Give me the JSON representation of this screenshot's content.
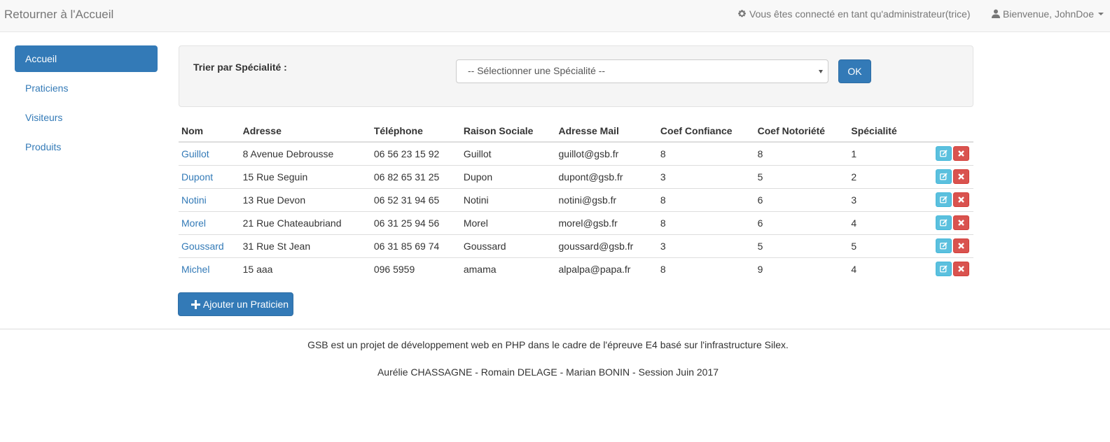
{
  "navbar": {
    "brand": "Retourner à l'Accueil",
    "admin_text": "Vous êtes connecté en tant qu'administrateur(trice)",
    "admin_icon": "gear-icon",
    "user_text": "Bienvenue, JohnDoe",
    "user_icon": "user-icon"
  },
  "sidebar": {
    "items": [
      {
        "label": "Accueil",
        "active": true
      },
      {
        "label": "Praticiens",
        "active": false
      },
      {
        "label": "Visiteurs",
        "active": false
      },
      {
        "label": "Produits",
        "active": false
      }
    ]
  },
  "filter": {
    "label": "Trier par Spécialité :",
    "selected": "-- Sélectionner une Spécialité --",
    "ok_label": "OK"
  },
  "table": {
    "headers": [
      "Nom",
      "Adresse",
      "Téléphone",
      "Raison Sociale",
      "Adresse Mail",
      "Coef Confiance",
      "Coef Notoriété",
      "Spécialité"
    ],
    "rows": [
      [
        "Guillot",
        "8 Avenue Debrousse",
        "06 56 23 15 92",
        "Guillot",
        "guillot@gsb.fr",
        "8",
        "8",
        "1"
      ],
      [
        "Dupont",
        "15 Rue Seguin",
        "06 82 65 31 25",
        "Dupon",
        "dupont@gsb.fr",
        "3",
        "5",
        "2"
      ],
      [
        "Notini",
        "13 Rue Devon",
        "06 52 31 94 65",
        "Notini",
        "notini@gsb.fr",
        "8",
        "6",
        "3"
      ],
      [
        "Morel",
        "21 Rue Chateaubriand",
        "06 31 25 94 56",
        "Morel",
        "morel@gsb.fr",
        "8",
        "6",
        "4"
      ],
      [
        "Goussard",
        "31 Rue St Jean",
        "06 31 85 69 74",
        "Goussard",
        "goussard@gsb.fr",
        "3",
        "5",
        "5"
      ],
      [
        "Michel",
        "15 aaa",
        "096 5959",
        "amama",
        "alpalpa@papa.fr",
        "8",
        "9",
        "4"
      ]
    ]
  },
  "add_button": {
    "label": "Ajouter un Praticien",
    "icon": "plus-icon"
  },
  "footer": {
    "line1": "GSB est un projet de développement web en PHP dans le cadre de l'épreuve E4 basé sur l'infrastructure Silex.",
    "line2": "Aurélie CHASSAGNE - Romain DELAGE - Marian BONIN - Session Juin 2017"
  },
  "colors": {
    "primary": "#337ab7",
    "info": "#5bc0de",
    "danger": "#d9534f"
  }
}
